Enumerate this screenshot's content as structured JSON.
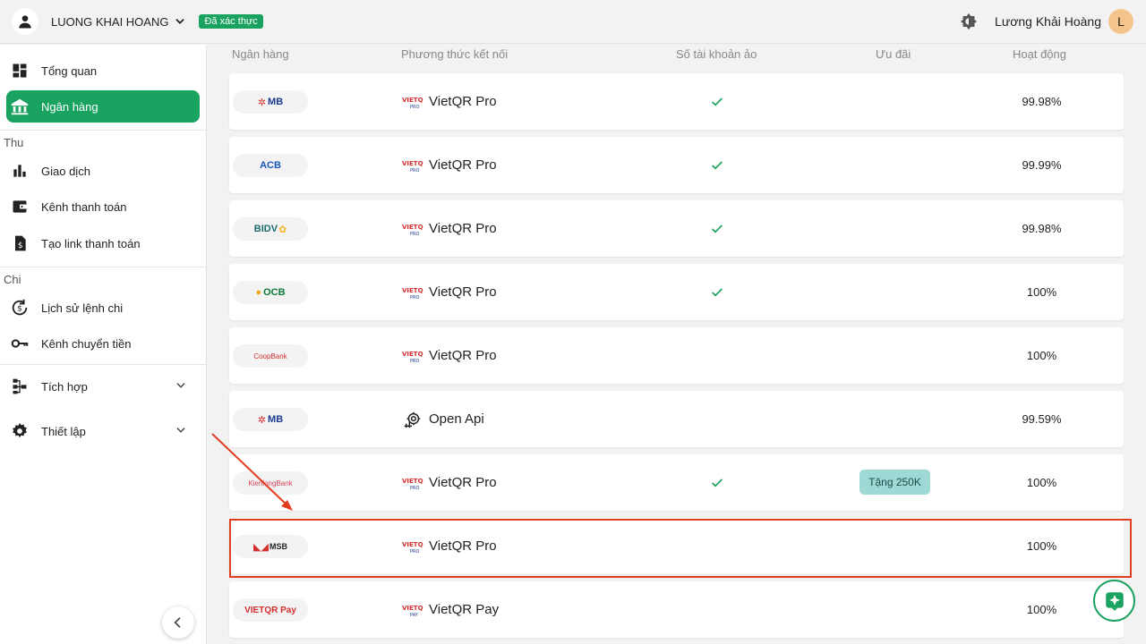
{
  "header": {
    "account_name": "LUONG KHAI HOANG",
    "verified_badge": "Đã xác thực",
    "user_name": "Lương Khải Hoàng",
    "user_initial": "L"
  },
  "sidebar": {
    "items": [
      {
        "label": "Tổng quan",
        "icon": "dashboard-icon"
      },
      {
        "label": "Ngân hàng",
        "icon": "bank-icon",
        "active": true
      },
      {
        "label": "Giao dịch",
        "icon": "bar-chart-icon"
      },
      {
        "label": "Kênh thanh toán",
        "icon": "wallet-icon"
      },
      {
        "label": "Tạo link thanh toán",
        "icon": "invoice-icon"
      },
      {
        "label": "Lịch sử lệnh chi",
        "icon": "history-icon"
      },
      {
        "label": "Kênh chuyển tiền",
        "icon": "key-icon"
      },
      {
        "label": "Tích hợp",
        "icon": "integration-icon"
      },
      {
        "label": "Thiết lập",
        "icon": "gear-icon"
      }
    ],
    "section_thu": "Thu",
    "section_chi": "Chi"
  },
  "table": {
    "headers": [
      "Ngân hàng",
      "Phương thức kết nối",
      "Số tài khoản ảo",
      "Ưu đãi",
      "Hoạt động"
    ],
    "rows": [
      {
        "bank": "MB",
        "method": "VietQR Pro",
        "virtual_account": true,
        "promo": "",
        "uptime": "99.98%"
      },
      {
        "bank": "ACB",
        "method": "VietQR Pro",
        "virtual_account": true,
        "promo": "",
        "uptime": "99.99%"
      },
      {
        "bank": "BIDV",
        "method": "VietQR Pro",
        "virtual_account": true,
        "promo": "",
        "uptime": "99.98%"
      },
      {
        "bank": "OCB",
        "method": "VietQR Pro",
        "virtual_account": true,
        "promo": "",
        "uptime": "100%"
      },
      {
        "bank": "CoopBank",
        "method": "VietQR Pro",
        "virtual_account": false,
        "promo": "",
        "uptime": "100%"
      },
      {
        "bank": "MB",
        "method": "Open Api",
        "virtual_account": false,
        "promo": "",
        "uptime": "99.59%"
      },
      {
        "bank": "KienlongBank",
        "method": "VietQR Pro",
        "virtual_account": true,
        "promo": "Tặng 250K",
        "uptime": "100%"
      },
      {
        "bank": "MSB",
        "method": "VietQR Pro",
        "virtual_account": false,
        "promo": "",
        "uptime": "100%"
      },
      {
        "bank": "VIETQR Pay",
        "method": "VietQR Pay",
        "virtual_account": false,
        "promo": "",
        "uptime": "100%"
      }
    ]
  },
  "colors": {
    "accent": "#1aa260",
    "highlight": "#e23d1e",
    "promo_bg": "#9fd9d6"
  }
}
